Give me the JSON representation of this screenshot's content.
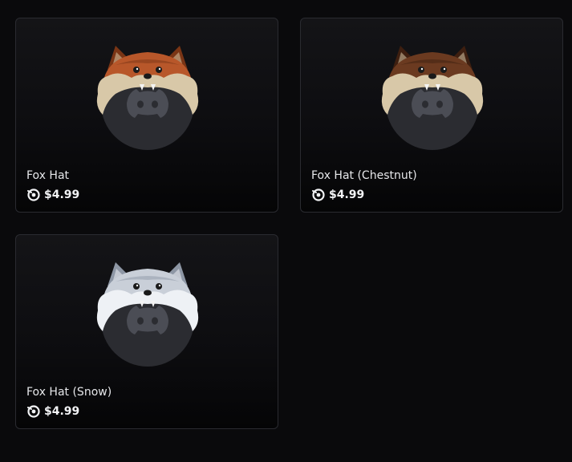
{
  "items": [
    {
      "name": "Fox Hat",
      "price": "$4.99",
      "icon": "fox-hat-orange-icon",
      "colors": {
        "fur": "#b8572a",
        "furDark": "#7a3515",
        "trim": "#d8c8a8"
      }
    },
    {
      "name": "Fox Hat (Chestnut)",
      "price": "$4.99",
      "icon": "fox-hat-chestnut-icon",
      "colors": {
        "fur": "#6b3a20",
        "furDark": "#3e1f10",
        "trim": "#d8c8a8"
      }
    },
    {
      "name": "Fox Hat (Snow)",
      "price": "$4.99",
      "icon": "fox-hat-snow-icon",
      "colors": {
        "fur": "#c9cfd8",
        "furDark": "#8e97a5",
        "trim": "#eef1f5"
      }
    }
  ],
  "currency_icon": "orb-icon",
  "avatar_icon": "discord-avatar-icon",
  "colors": {
    "background": "#0a0a0c",
    "card_border": "#2a2b30",
    "avatar": "#2b2c31",
    "avatar_logo": "#4b4d55"
  }
}
